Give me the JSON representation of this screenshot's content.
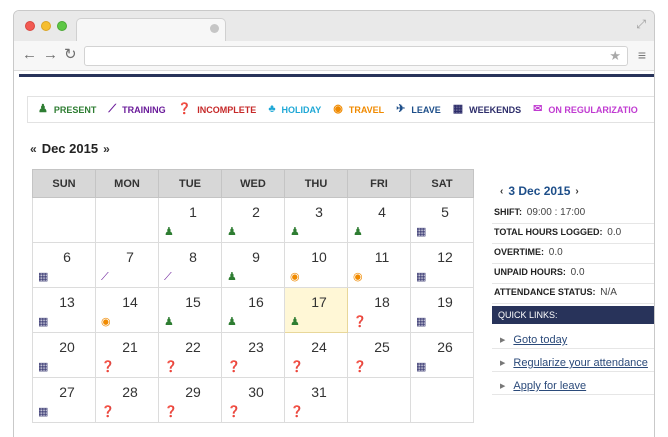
{
  "colors": {
    "present": "#2e7d32",
    "training": "#6a1b9a",
    "incomplete": "#c62828",
    "holiday": "#1fa8d6",
    "travel": "#f08a00",
    "leave": "#1d4e89",
    "weekends": "#2d2d6a",
    "on_regularization": "#c03bd1",
    "header_bar": "#28335a",
    "today_bg": "#fff7d6"
  },
  "legend": [
    {
      "icon": "person-icon",
      "label": "PRESENT",
      "color": "#2e7d32"
    },
    {
      "icon": "line-chart-icon",
      "label": "TRAINING",
      "color": "#6a1b9a"
    },
    {
      "icon": "question-circle-icon",
      "label": "INCOMPLETE",
      "color": "#c62828"
    },
    {
      "icon": "tree-icon",
      "label": "HOLIDAY",
      "color": "#1fa8d6"
    },
    {
      "icon": "globe-icon",
      "label": "TRAVEL",
      "color": "#f08a00"
    },
    {
      "icon": "plane-icon",
      "label": "LEAVE",
      "color": "#1d4e89"
    },
    {
      "icon": "calendar-icon",
      "label": "WEEKENDS",
      "color": "#2d2d6a"
    },
    {
      "icon": "chat-icon",
      "label": "ON REGULARIZATIO",
      "color": "#c03bd1"
    }
  ],
  "month": {
    "prev": "«",
    "label": "Dec 2015",
    "next": "»"
  },
  "weekdays": [
    "SUN",
    "MON",
    "TUE",
    "WED",
    "THU",
    "FRI",
    "SAT"
  ],
  "weeks": [
    [
      null,
      null,
      {
        "day": "1",
        "status": "present"
      },
      {
        "day": "2",
        "status": "present"
      },
      {
        "day": "3",
        "status": "present"
      },
      {
        "day": "4",
        "status": "present"
      },
      {
        "day": "5",
        "status": "weekends"
      }
    ],
    [
      {
        "day": "6",
        "status": "weekends"
      },
      {
        "day": "7",
        "status": "training"
      },
      {
        "day": "8",
        "status": "training"
      },
      {
        "day": "9",
        "status": "present"
      },
      {
        "day": "10",
        "status": "travel"
      },
      {
        "day": "11",
        "status": "travel"
      },
      {
        "day": "12",
        "status": "weekends"
      }
    ],
    [
      {
        "day": "13",
        "status": "weekends"
      },
      {
        "day": "14",
        "status": "travel"
      },
      {
        "day": "15",
        "status": "present"
      },
      {
        "day": "16",
        "status": "present"
      },
      {
        "day": "17",
        "status": "present",
        "today": true
      },
      {
        "day": "18",
        "status": "incomplete"
      },
      {
        "day": "19",
        "status": "weekends"
      }
    ],
    [
      {
        "day": "20",
        "status": "weekends"
      },
      {
        "day": "21",
        "status": "incomplete"
      },
      {
        "day": "22",
        "status": "incomplete"
      },
      {
        "day": "23",
        "status": "incomplete"
      },
      {
        "day": "24",
        "status": "incomplete"
      },
      {
        "day": "25",
        "status": "incomplete"
      },
      {
        "day": "26",
        "status": "weekends"
      }
    ],
    [
      {
        "day": "27",
        "status": "weekends"
      },
      {
        "day": "28",
        "status": "incomplete"
      },
      {
        "day": "29",
        "status": "incomplete"
      },
      {
        "day": "30",
        "status": "incomplete"
      },
      {
        "day": "31",
        "status": "incomplete"
      },
      null,
      null
    ]
  ],
  "detail": {
    "prev": "‹",
    "date": "3 Dec 2015",
    "next": "›",
    "shift_label": "SHIFT:",
    "shift_value": "09:00 : 17:00",
    "hours_label": "TOTAL HOURS LOGGED:",
    "hours_value": "0.0",
    "overtime_label": "OVERTIME:",
    "overtime_value": "0.0",
    "unpaid_label": "UNPAID HOURS:",
    "unpaid_value": "0.0",
    "status_label": "ATTENDANCE STATUS:",
    "status_value": "N/A"
  },
  "quick_links": {
    "heading": "QUICK LINKS:",
    "items": [
      "Goto today",
      "Regularize your attendance",
      "Apply for leave"
    ]
  }
}
